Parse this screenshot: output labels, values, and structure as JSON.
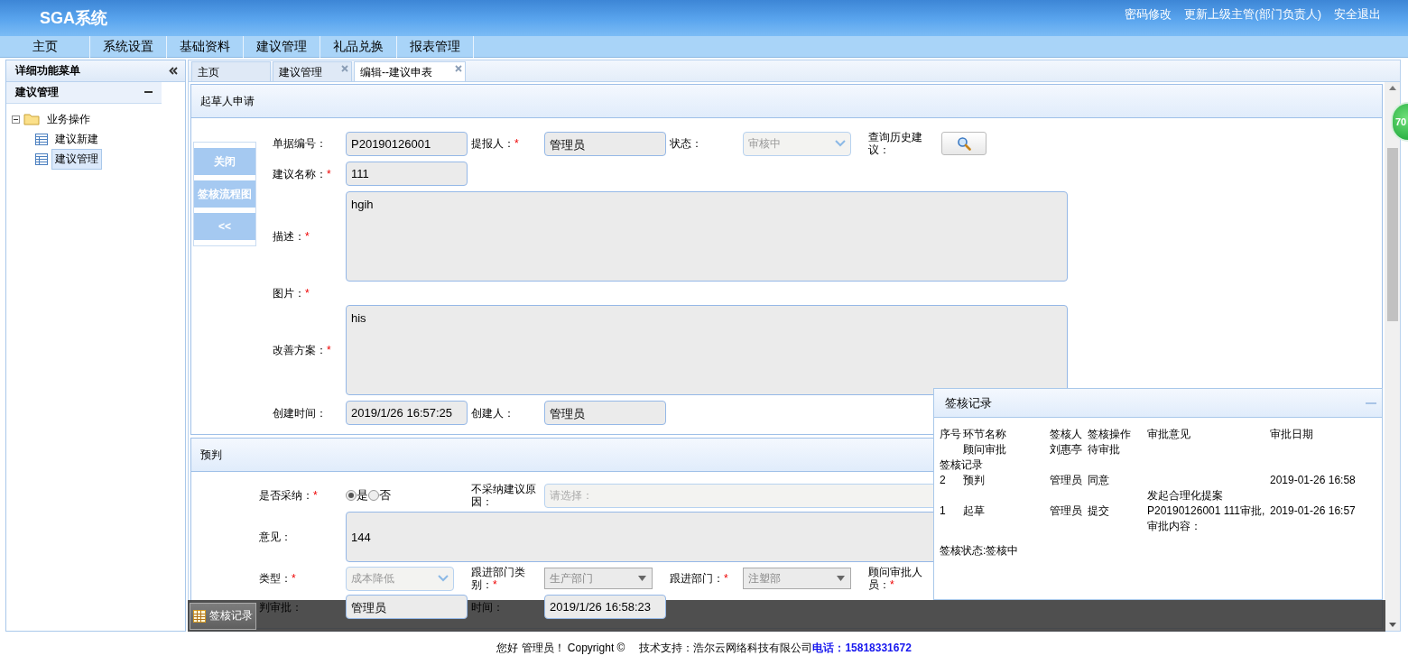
{
  "header": {
    "logo": "SGA系统",
    "links": [
      "密码修改",
      "更新上级主管(部门负责人)",
      "安全退出"
    ]
  },
  "menu": [
    "主页",
    "系统设置",
    "基础资料",
    "建议管理",
    "礼品兑换",
    "报表管理"
  ],
  "sidebar": {
    "title": "详细功能菜单",
    "section": "建议管理",
    "tree": [
      {
        "label": "业务操作",
        "expanded": true,
        "children": [
          {
            "label": "建议新建",
            "selected": false
          },
          {
            "label": "建议管理",
            "selected": true
          }
        ]
      }
    ]
  },
  "tabs": [
    {
      "label": "主页",
      "selected": false,
      "closable": false
    },
    {
      "label": "建议管理",
      "selected": false,
      "closable": true
    },
    {
      "label": "编辑--建议申表",
      "selected": true,
      "closable": true
    }
  ],
  "side_buttons": [
    "关闭",
    "签核流程图",
    "<<"
  ],
  "sections": [
    {
      "title": "起草人申请",
      "kind": "draft",
      "rows": [
        {
          "items": [
            {
              "kind": "label",
              "text": "单据编号："
            },
            {
              "kind": "input",
              "value": "P20190126001"
            },
            {
              "kind": "label",
              "text": "提报人：",
              "mark": "*"
            },
            {
              "kind": "input",
              "value": "管理员"
            },
            {
              "kind": "label",
              "text": "状态："
            },
            {
              "kind": "combo",
              "value": "审核中",
              "disabled": true
            },
            {
              "kind": "label",
              "text": "查询历史建议："
            },
            {
              "kind": "search_button"
            }
          ]
        },
        {
          "items": [
            {
              "kind": "label",
              "text": "建议名称：",
              "mark": "*"
            },
            {
              "kind": "input",
              "value": "111"
            }
          ]
        },
        {
          "items": [
            {
              "kind": "label",
              "text": "描述：",
              "mark": "*"
            },
            {
              "kind": "textarea",
              "value": "hgih"
            }
          ]
        },
        {
          "items": [
            {
              "kind": "label",
              "text": "图片：",
              "mark": "*"
            }
          ]
        },
        {
          "items": [
            {
              "kind": "label",
              "text": "改善方案：",
              "mark": "*"
            },
            {
              "kind": "textarea",
              "value": "his"
            }
          ]
        },
        {
          "items": [
            {
              "kind": "label",
              "text": "创建时间："
            },
            {
              "kind": "input",
              "value": "2019/1/26 16:57:25"
            },
            {
              "kind": "label",
              "text": "创建人："
            },
            {
              "kind": "input",
              "value": "管理员"
            }
          ]
        }
      ]
    },
    {
      "title": "预判",
      "kind": "review",
      "rows": [
        {
          "items": [
            {
              "kind": "label",
              "text": "是否采纳：",
              "mark": "*"
            },
            {
              "kind": "radio",
              "options": [
                {
                  "label": "是",
                  "selected": true
                },
                {
                  "label": "否",
                  "selected": false
                }
              ]
            },
            {
              "kind": "label",
              "text": "不采纳建议原因："
            },
            {
              "kind": "wide_select",
              "placeholder": "请选择："
            }
          ]
        },
        {
          "items": [
            {
              "kind": "label",
              "text": "意见："
            },
            {
              "kind": "note",
              "value": "144"
            }
          ]
        },
        {
          "items": [
            {
              "kind": "label",
              "text": "类型：",
              "mark": "*"
            },
            {
              "kind": "combo",
              "value": "成本降低",
              "disabled": true
            },
            {
              "kind": "label",
              "text": "跟进部门类别：",
              "mark": "*"
            },
            {
              "kind": "dropdown",
              "value": "生产部门",
              "disabled": true
            },
            {
              "kind": "label",
              "text": "跟进部门：",
              "mark": "*"
            },
            {
              "kind": "dropdown",
              "value": "注塑部",
              "disabled": true
            },
            {
              "kind": "label",
              "text": "顾问审批人员：",
              "mark": "*"
            }
          ]
        },
        {
          "items": [
            {
              "kind": "label",
              "text": "判审批："
            },
            {
              "kind": "input",
              "value": "管理员"
            },
            {
              "kind": "label",
              "text": "时间："
            },
            {
              "kind": "input",
              "value": "2019/1/26 16:58:23"
            }
          ]
        }
      ]
    }
  ],
  "approval_panel": {
    "title": "签核记录",
    "columns": [
      "序号",
      "环节名称",
      "签核人",
      "签核操作",
      "审批意见",
      "审批日期"
    ],
    "pending": {
      "step": "顾问审批",
      "approver": "刘惠亭",
      "action": "待审批"
    },
    "records_title": "签核记录",
    "records": [
      {
        "no": "2",
        "step": "预判",
        "approver": "管理员",
        "action": "同意",
        "date": "2019-01-26 16:58"
      },
      {
        "no": "1",
        "step": "起草",
        "approver": "管理员",
        "action": "提交",
        "comment": "发起合理化提案 P20190126001 111审批,审批内容：",
        "date": "2019-01-26 16:57"
      }
    ],
    "status": "签核状态:签核中"
  },
  "bottom_bar": {
    "button": "签核记录"
  },
  "badge": "70",
  "footer": {
    "greeting": "您好 管理员！ Copyright ©",
    "support": "技术支持：浩尔云网络科技有限公司",
    "phone": "电话：15818331672"
  }
}
